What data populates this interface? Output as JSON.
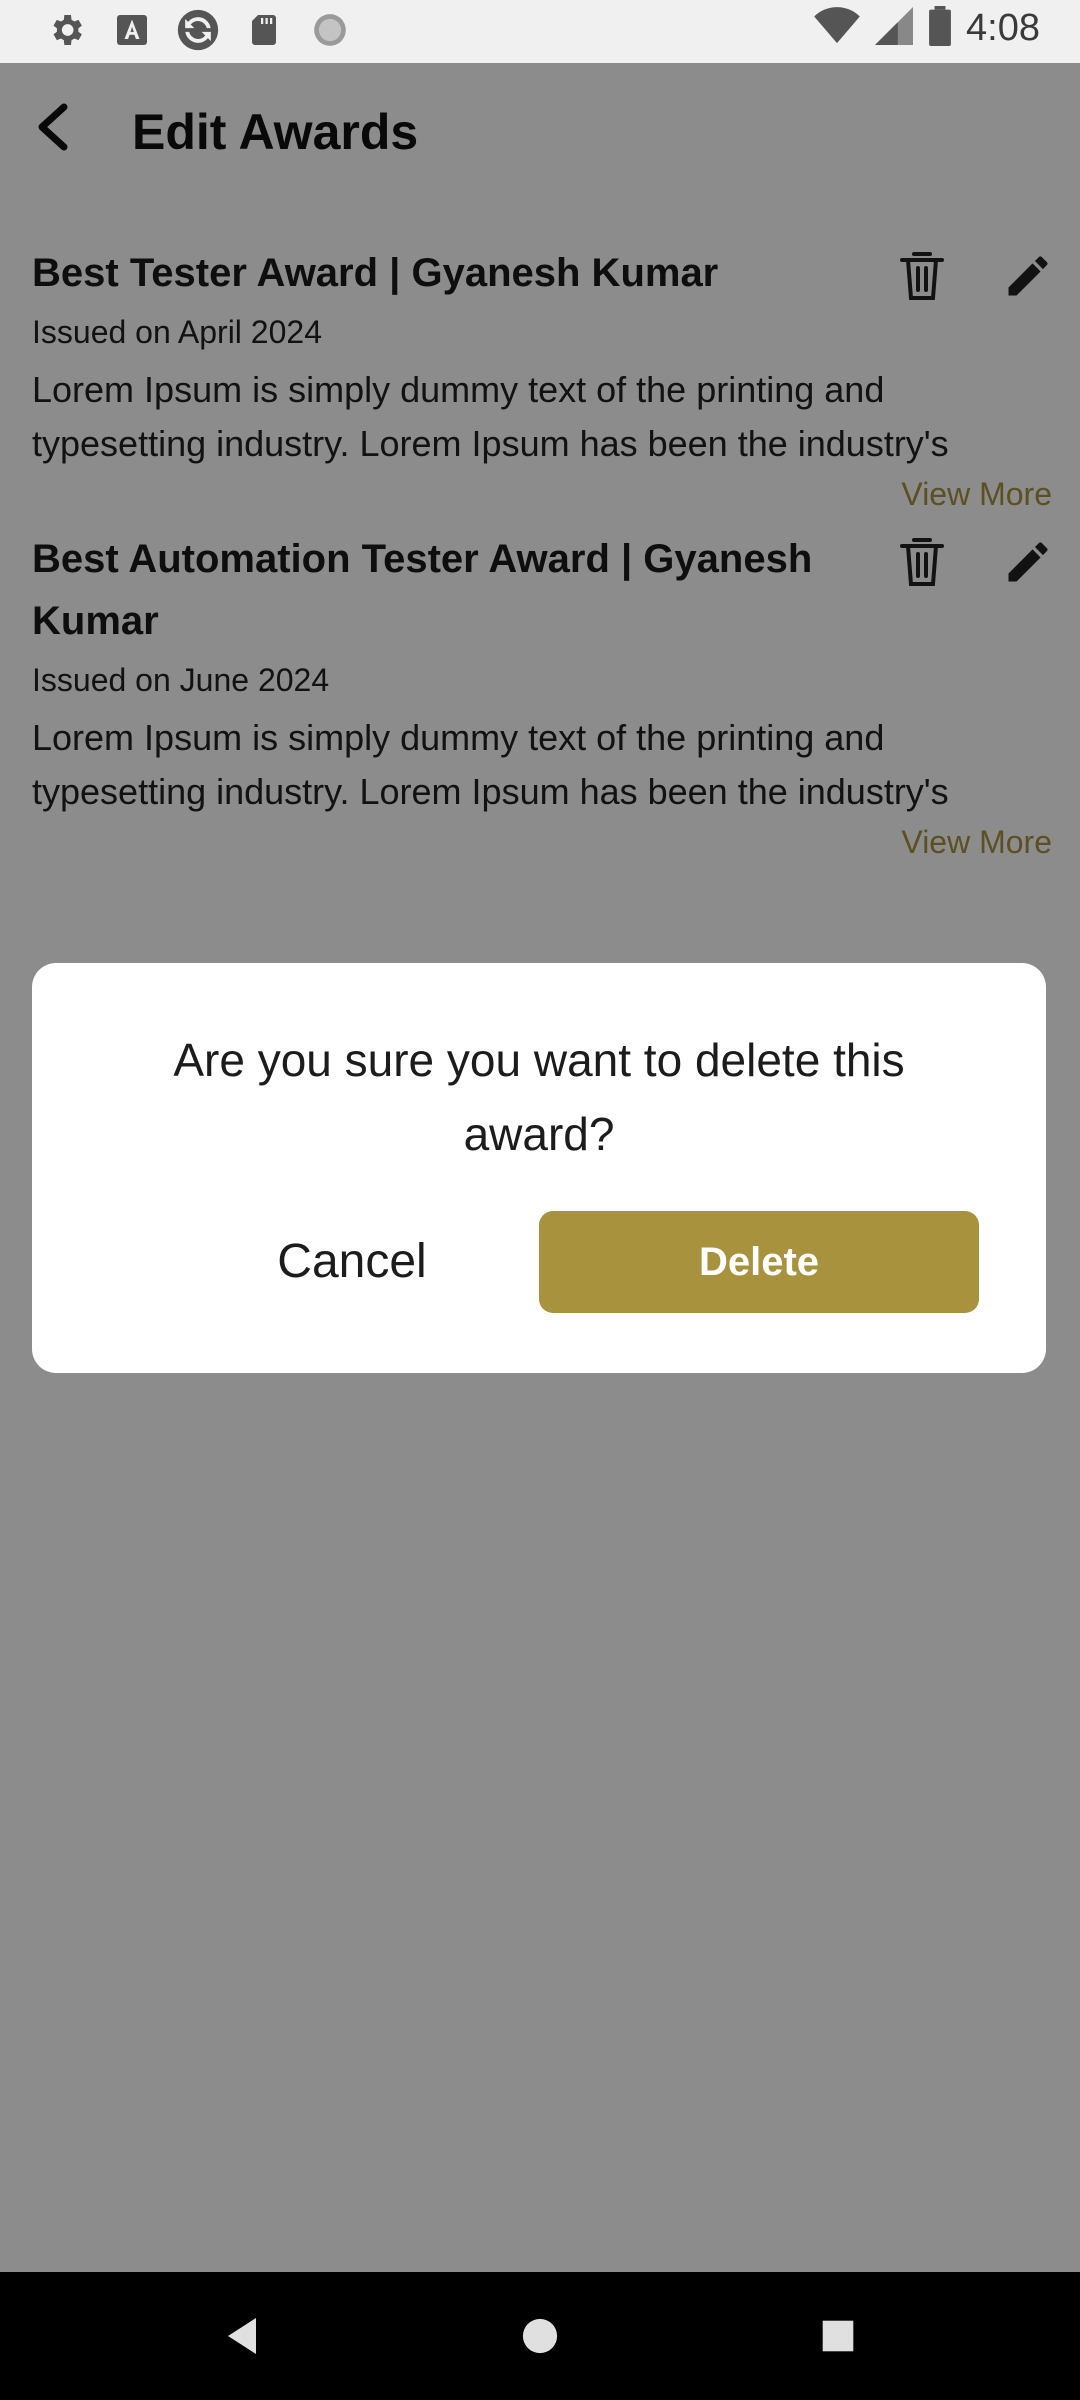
{
  "status_bar": {
    "time": "4:08",
    "left_icons": [
      "settings-icon",
      "font-icon",
      "sync-icon",
      "sd-card-icon",
      "circle-icon"
    ],
    "right_icons": [
      "wifi-icon",
      "signal-icon",
      "battery-icon"
    ]
  },
  "header": {
    "title": "Edit Awards",
    "back_icon": "back-arrow-icon"
  },
  "awards": [
    {
      "title": "Best Tester Award | Gyanesh Kumar",
      "issued": "Issued on April 2024",
      "description": "Lorem Ipsum is simply dummy text of the printing and typesetting industry. Lorem Ipsum has been the industry's",
      "view_more": "View More"
    },
    {
      "title": "Best Automation Tester Award | Gyanesh Kumar",
      "issued": "Issued on June 2024",
      "description": "Lorem Ipsum is simply dummy text of the printing and typesetting industry. Lorem Ipsum has been the industry's",
      "view_more": "View More"
    }
  ],
  "dialog": {
    "message": "Are you sure you want to delete this award?",
    "cancel_label": "Cancel",
    "delete_label": "Delete"
  },
  "nav_bar": {
    "icons": [
      "nav-back-icon",
      "nav-home-icon",
      "nav-recents-icon"
    ]
  },
  "colors": {
    "accent": "#a8923e",
    "scrim": "#000000",
    "dialog_bg": "#ffffff",
    "status_bar_bg": "#f0f0f0",
    "nav_bar_bg": "#000000"
  }
}
